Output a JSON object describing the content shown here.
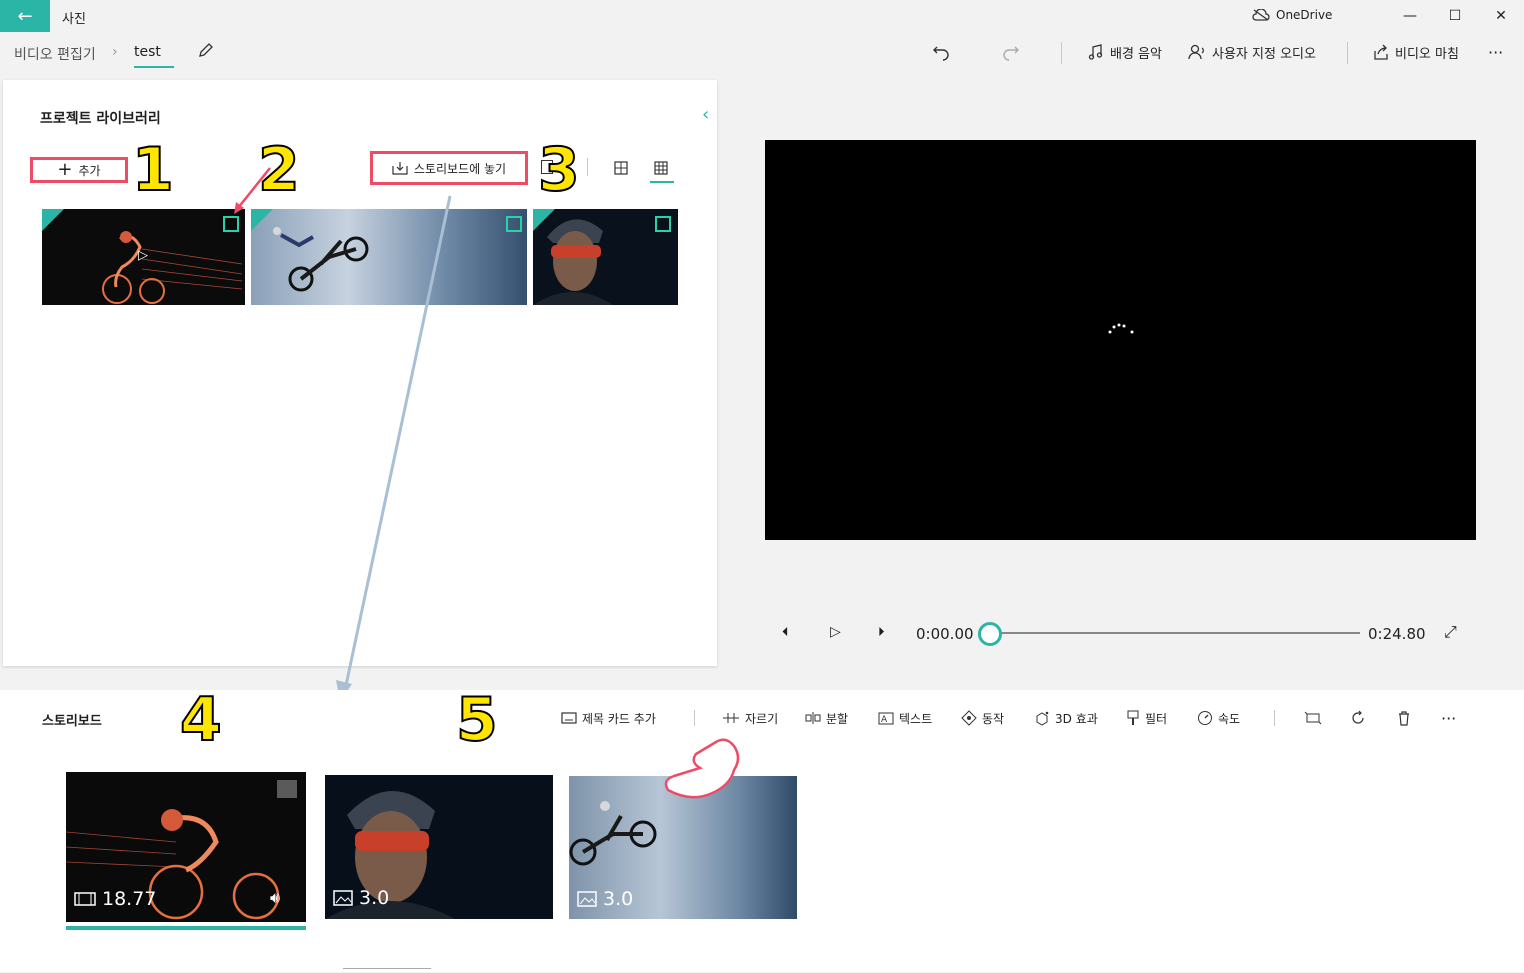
{
  "app": {
    "back_glyph": "←",
    "title": "사진",
    "onedrive": "OneDrive"
  },
  "window": {
    "minimize": "—",
    "maximize": "☐",
    "close": "✕"
  },
  "breadcrumb": {
    "root": "비디오 편집기",
    "separator": "›",
    "current": "test"
  },
  "toolbar": {
    "background_music": "배경 음악",
    "custom_audio": "사용자 지정 오디오",
    "finish_video": "비디오 마침",
    "more": "···"
  },
  "library": {
    "title": "프로젝트 라이브러리",
    "add": "추가",
    "place_storyboard": "스토리보드에 놓기",
    "collapse": "‹"
  },
  "annotations": [
    "1",
    "2",
    "3",
    "4",
    "5"
  ],
  "player": {
    "current_time": "0:00.00",
    "end_time": "0:24.80",
    "progress": 0.0
  },
  "storyboard": {
    "title": "스토리보드",
    "tools": {
      "title_card": "제목 카드 추가",
      "trim": "자르기",
      "split": "분할",
      "text": "텍스트",
      "motion": "동작",
      "effects_3d": "3D 효과",
      "filters": "필터",
      "speed": "속도"
    },
    "clips": [
      {
        "duration": "18.77",
        "kind": "video"
      },
      {
        "duration": "3.0",
        "kind": "image"
      },
      {
        "duration": "3.0",
        "kind": "image"
      }
    ]
  },
  "colors": {
    "accent": "#2bb5a6",
    "highlight": "#ee4c66",
    "badge": "#ffe600"
  }
}
